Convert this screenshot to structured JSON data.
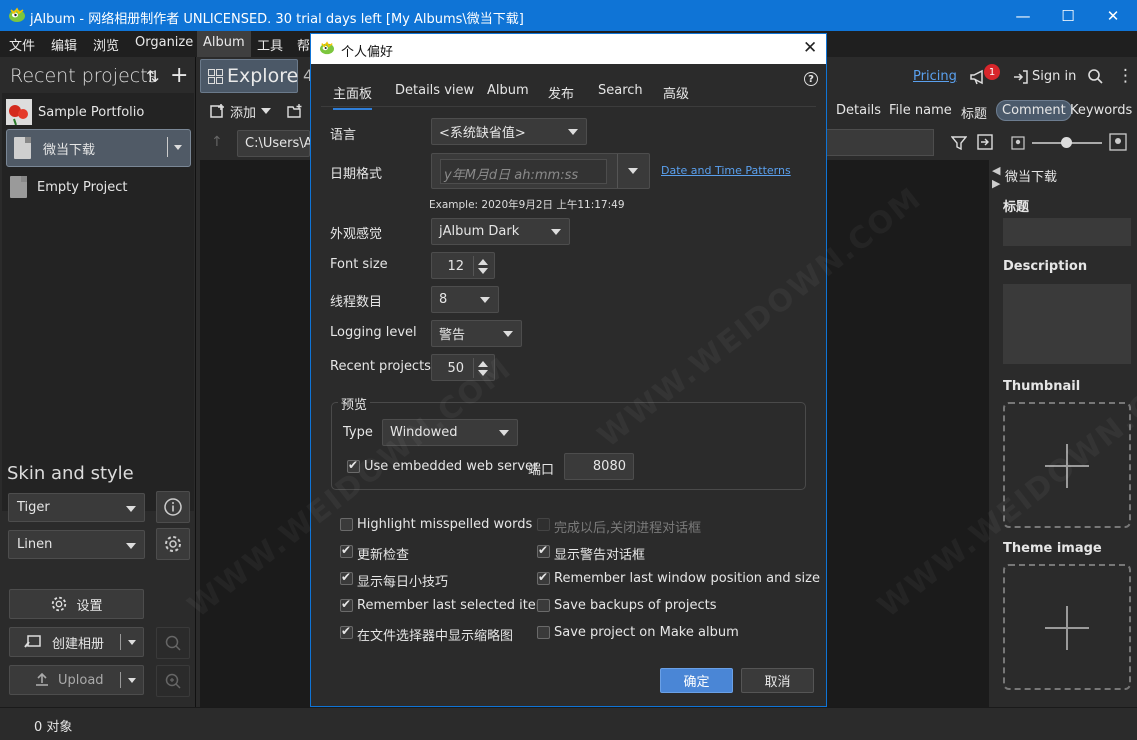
{
  "window": {
    "title": "jAlbum - 网络相册制作者 UNLICENSED. 30 trial days left [My Albums\\微当下载]",
    "minimize_glyph": "—",
    "maximize_glyph": "☐",
    "close_glyph": "✕"
  },
  "menubar": [
    "文件",
    "编辑",
    "浏览",
    "Organize",
    "Album",
    "工具",
    "帮"
  ],
  "left": {
    "recent_title": "Recent projects",
    "sort_glyph": "⇅",
    "add_glyph": "+",
    "projects": [
      {
        "label": "Sample Portfolio"
      },
      {
        "label": "微当下载"
      },
      {
        "label": "Empty Project"
      }
    ],
    "skin_title": "Skin and style",
    "skin_value": "Tiger",
    "style_value": "Linen",
    "settings_label": "设置",
    "create_label": "创建相册",
    "upload_label": "Upload"
  },
  "middle": {
    "explore_label": "Explore",
    "add_label": "添加",
    "path_value": "C:\\Users\\A",
    "hidden_tab_glyph": "4"
  },
  "top_right": {
    "pricing": "Pricing",
    "notifications_count": "1",
    "sign_in": "Sign in"
  },
  "view_tabs": [
    "Details",
    "File name",
    "标题",
    "Comment",
    "Keywords"
  ],
  "properties": {
    "folder_name": "微当下载",
    "title_label": "标题",
    "description_label": "Description",
    "thumbnail_label": "Thumbnail",
    "theme_image_label": "Theme image"
  },
  "status": {
    "text": "0 对象"
  },
  "dialog": {
    "title": "个人偏好",
    "close_glyph": "✕",
    "help_glyph": "?",
    "tabs": [
      "主面板",
      "Details view",
      "Album",
      "发布",
      "Search",
      "高级"
    ],
    "language_label": "语言",
    "language_value": "<系统缺省值>",
    "date_format_label": "日期格式",
    "date_format_placeholder": "y年M月d日 ah:mm:ss",
    "date_patterns_link": "Date and Time Patterns",
    "date_example": "Example: 2020年9月2日 上午11:17:49",
    "look_label": "外观感觉",
    "look_value": "jAlbum Dark",
    "font_size_label": "Font size",
    "font_size_value": "12",
    "threads_label": "线程数目",
    "threads_value": "8",
    "logging_label": "Logging level",
    "logging_value": "警告",
    "recent_label": "Recent projects",
    "recent_value": "50",
    "preview_group": "预览",
    "type_label": "Type",
    "type_value": "Windowed",
    "embedded_label": "Use embedded web server",
    "port_label": "端口",
    "port_value": "8080",
    "options": [
      {
        "label": "Highlight misspelled words",
        "checked": false,
        "disabled": false
      },
      {
        "label": "完成以后,关闭进程对话框",
        "checked": false,
        "disabled": true
      },
      {
        "label": "更新检查",
        "checked": true,
        "disabled": false
      },
      {
        "label": "显示警告对话框",
        "checked": true,
        "disabled": false
      },
      {
        "label": "显示每日小技巧",
        "checked": true,
        "disabled": false
      },
      {
        "label": "Remember last window position and size",
        "checked": true,
        "disabled": false
      },
      {
        "label": "Remember last selected item",
        "checked": true,
        "disabled": false
      },
      {
        "label": "Save backups of projects",
        "checked": false,
        "disabled": false
      },
      {
        "label": "在文件选择器中显示缩略图",
        "checked": true,
        "disabled": false
      },
      {
        "label": "Save project on Make album",
        "checked": false,
        "disabled": false
      }
    ],
    "ok_label": "确定",
    "cancel_label": "取消"
  },
  "watermark": "WWW.WEIDOWN.COM",
  "colors": {
    "title_bar": "#0f74d6",
    "background": "#2b2b2b",
    "accent": "#2f7ed8",
    "ok_button": "#4a86d6",
    "selected_tab": "#4b5867"
  }
}
